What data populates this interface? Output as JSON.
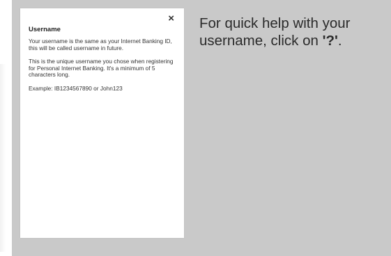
{
  "help_card": {
    "close_glyph": "×",
    "title": "Username",
    "paragraphs": [
      "Your username is the same as your Internet Banking ID, this will be called username in future.",
      "This is the unique username you chose when registering for Personal Internet Banking. It's a minimum of 5 characters long.",
      "Example: IB1234567890 or John123"
    ]
  },
  "tip": {
    "prefix": "For quick help with your username, click on ",
    "key": "'?'",
    "suffix": "."
  },
  "colors": {
    "overlay": "#c9c9c9",
    "card": "#ffffff",
    "text": "#2b2b2b"
  }
}
